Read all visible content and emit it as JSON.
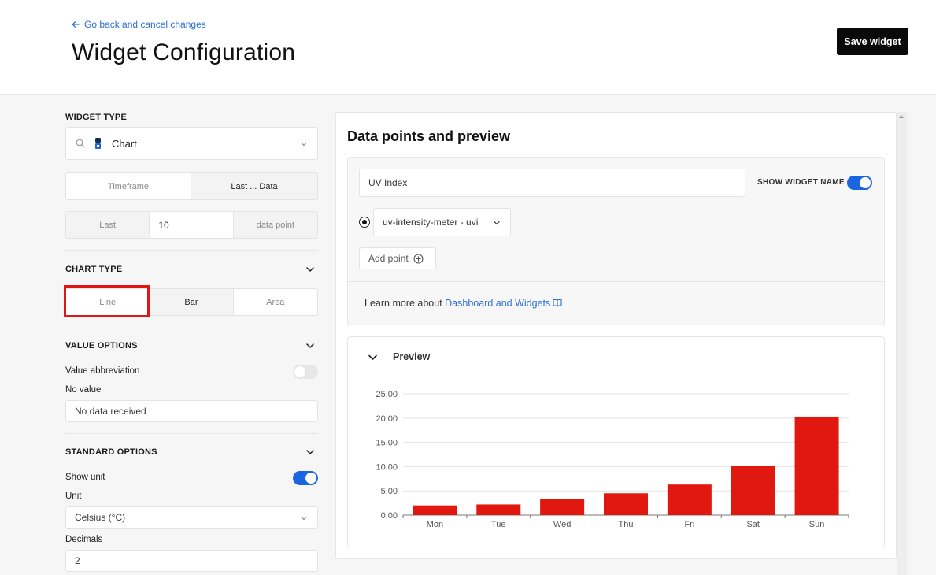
{
  "header": {
    "back_label": "Go back and cancel changes",
    "title": "Widget Configuration",
    "save_label": "Save widget"
  },
  "left": {
    "widget_type": {
      "label": "WIDGET TYPE",
      "selected": "Chart",
      "icon": "chart-logo-icon"
    },
    "source_tabs": [
      "Timeframe",
      "Last ... Data"
    ],
    "last_row": {
      "prefix": "Last",
      "value": "10",
      "suffix": "data point"
    },
    "chart_type": {
      "label": "CHART TYPE",
      "options": [
        "Line",
        "Bar",
        "Area"
      ],
      "selected": "Bar"
    },
    "value_options": {
      "label": "VALUE OPTIONS",
      "abbreviation_label": "Value abbreviation",
      "abbreviation_on": false,
      "no_value_label": "No value",
      "no_value_value": "No data received"
    },
    "standard_options": {
      "label": "STANDARD OPTIONS",
      "show_unit_label": "Show unit",
      "show_unit_on": true,
      "unit_label": "Unit",
      "unit_value": "Celsius (°C)",
      "decimals_label": "Decimals",
      "decimals_value": "2"
    }
  },
  "right": {
    "title": "Data points and preview",
    "widget_name_value": "UV Index",
    "show_widget_name_label": "SHOW WIDGET NAME",
    "show_widget_name_on": true,
    "data_point_select": "uv-intensity-meter - uvi",
    "add_point_label": "Add point",
    "learn_more_text": "Learn more about ",
    "learn_more_link": "Dashboard and Widgets",
    "preview_label": "Preview"
  },
  "colors": {
    "accent": "#1b66e0",
    "link": "#2c6fd6",
    "bar": "#e0180f",
    "highlight": "#e01616"
  },
  "chart_data": {
    "type": "bar",
    "categories": [
      "Mon",
      "Tue",
      "Wed",
      "Thu",
      "Fri",
      "Sat",
      "Sun"
    ],
    "values": [
      2.0,
      2.2,
      3.3,
      4.5,
      6.3,
      10.2,
      20.3
    ],
    "yticks": [
      "0.00",
      "5.00",
      "10.00",
      "15.00",
      "20.00",
      "25.00"
    ],
    "ylim": [
      0,
      25
    ],
    "grid": true
  }
}
